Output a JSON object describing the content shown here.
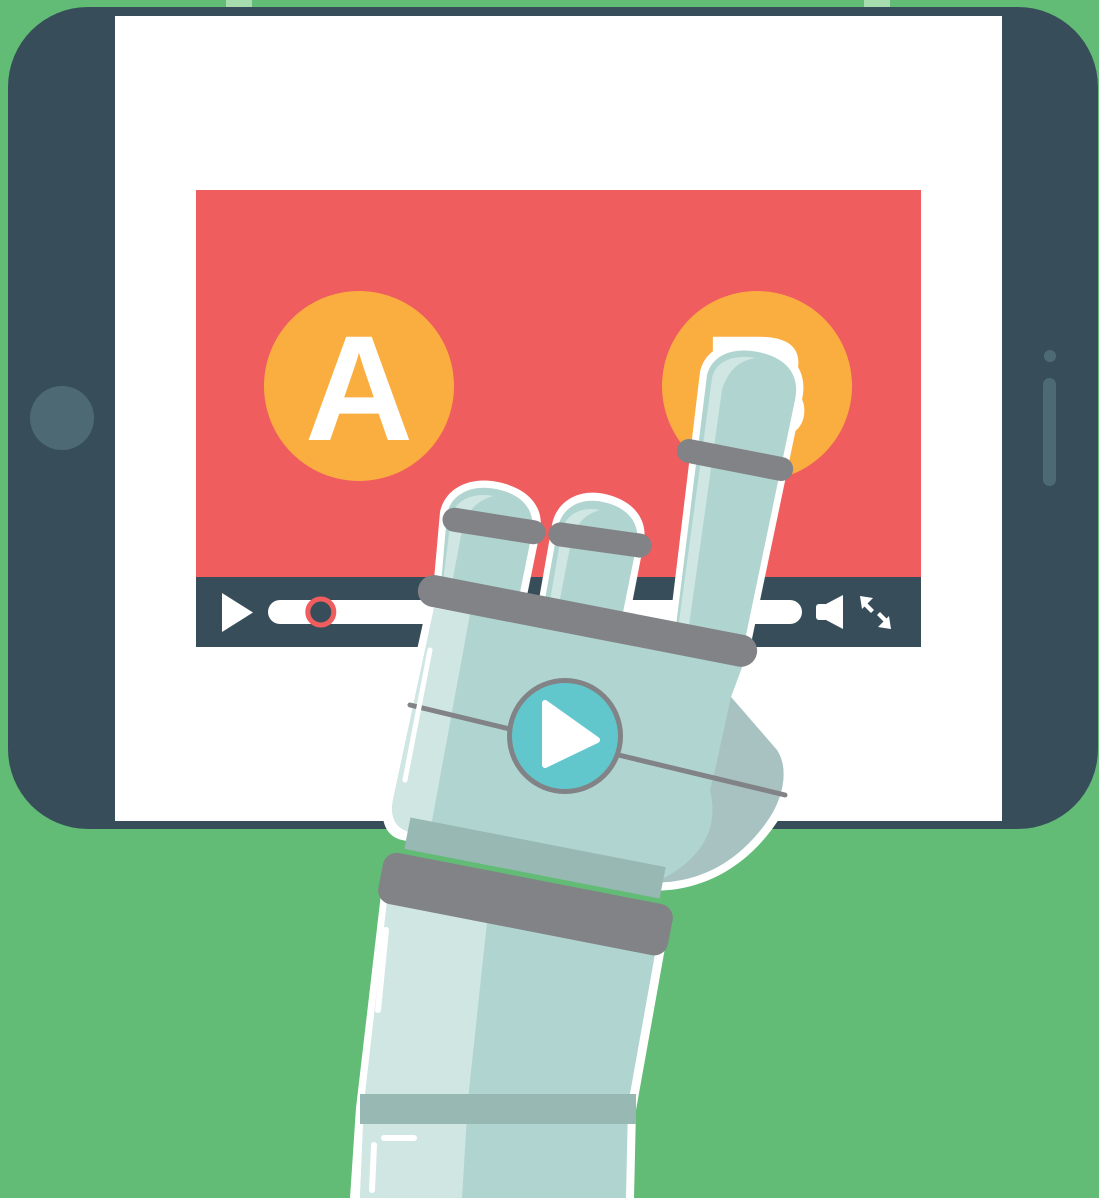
{
  "colors": {
    "background": "#62bc76",
    "tablet_body": "#374e5a",
    "screen": "#ffffff",
    "video_area": "#ef5d5e",
    "control_bar": "#374e5a",
    "option_circle": "#fbae40",
    "option_letter": "#ffffff",
    "scrub_marker": "#ef5d5e",
    "robot_light": "#cfe6e3",
    "robot_mid": "#b0d4d0",
    "robot_shadow": "#a8c2c2",
    "robot_band": "#818386",
    "robot_play_button": "#62c7cd",
    "home_button": "#4d6a74"
  },
  "video": {
    "option_a": "A",
    "option_b": "B",
    "playback_progress": 0.08
  },
  "icons": {
    "play": "play-icon",
    "volume": "volume-icon",
    "fullscreen": "fullscreen-icon",
    "robot_play": "play-icon"
  }
}
